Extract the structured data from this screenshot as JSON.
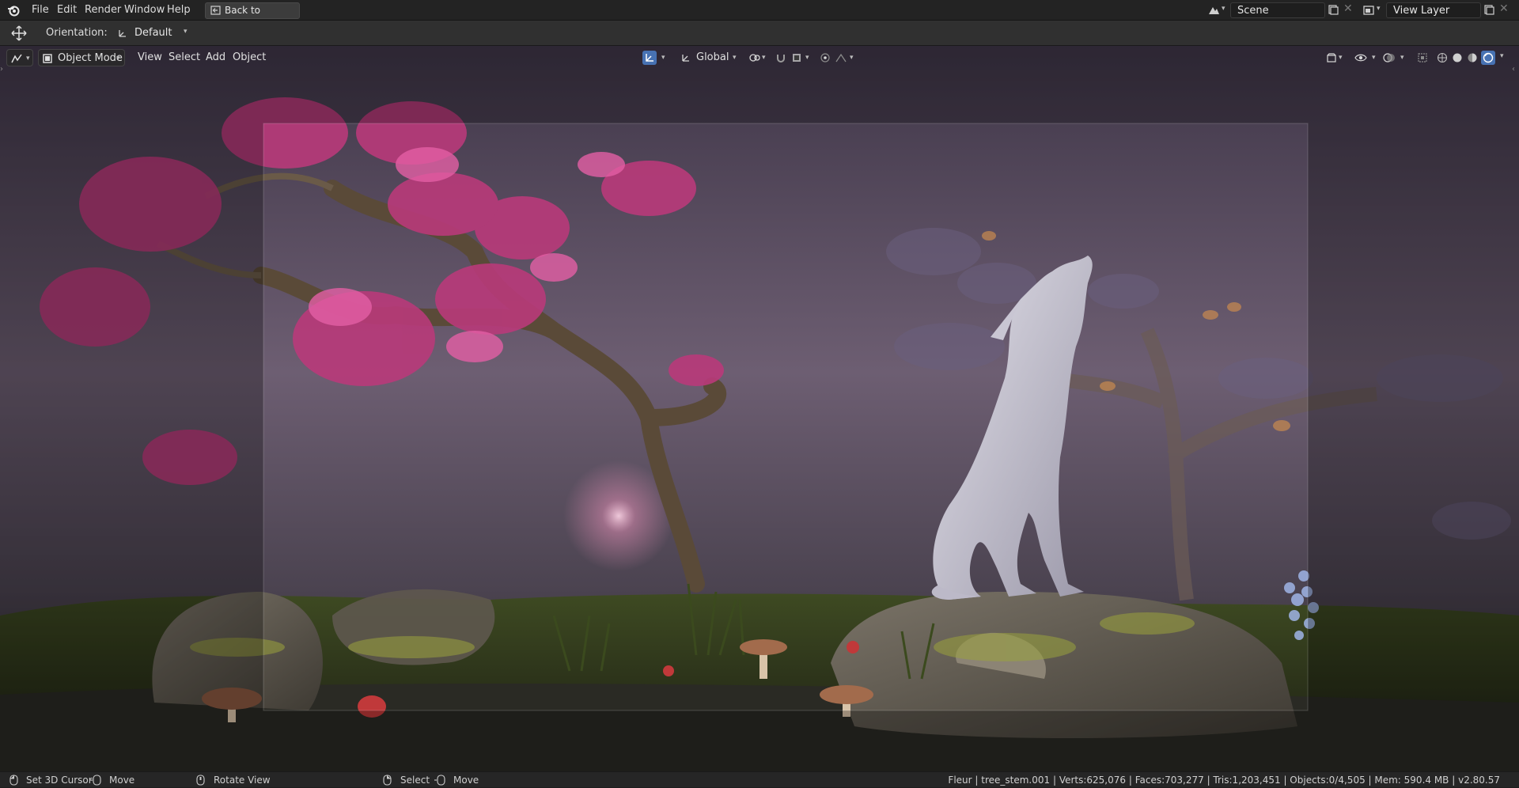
{
  "menu": {
    "items": [
      {
        "key": "file",
        "label": "File"
      },
      {
        "key": "edit",
        "label": "Edit"
      },
      {
        "key": "render",
        "label": "Render"
      },
      {
        "key": "window",
        "label": "Window"
      },
      {
        "key": "help",
        "label": "Help"
      }
    ],
    "back_button": "Back to Previous"
  },
  "scene": {
    "name": "Scene",
    "view_layer": "View Layer"
  },
  "tool_settings": {
    "orientation_label": "Orientation:",
    "orientation_value": "Default"
  },
  "viewport_header": {
    "mode": "Object Mode",
    "menus": [
      {
        "key": "view",
        "label": "View"
      },
      {
        "key": "select",
        "label": "Select"
      },
      {
        "key": "add",
        "label": "Add"
      },
      {
        "key": "object",
        "label": "Object"
      }
    ],
    "transform_orientation": "Global"
  },
  "status": {
    "left": [
      {
        "key": "set-3d-cursor",
        "label": "Set 3D Cursor"
      },
      {
        "key": "move",
        "label": "Move"
      },
      {
        "key": "rotate-view",
        "label": "Rotate View"
      },
      {
        "key": "select",
        "label": "Select"
      },
      {
        "key": "move2",
        "label": "Move"
      }
    ],
    "stats": "Fleur | tree_stem.001 | Verts:625,076 | Faces:703,277 | Tris:1,203,451 | Objects:0/4,505 | Mem: 590.4 MB | v2.80.57"
  },
  "icons": [
    "blender-logo-icon",
    "back-icon",
    "move-tool-icon",
    "orientation-icon",
    "editor-type-icon",
    "object-mode-icon",
    "gizmo-icon",
    "global-icon",
    "pivot-icon",
    "snap-icon",
    "proportional-icon",
    "visibility-icon",
    "overlay-icon",
    "xray-icon",
    "shading-wire-icon",
    "shading-solid-icon",
    "shading-material-icon",
    "shading-rendered-icon",
    "mouse-icon"
  ],
  "colors": {
    "accent": "#4772b3",
    "header_bg": "#232323",
    "tool_bg": "#303030"
  }
}
